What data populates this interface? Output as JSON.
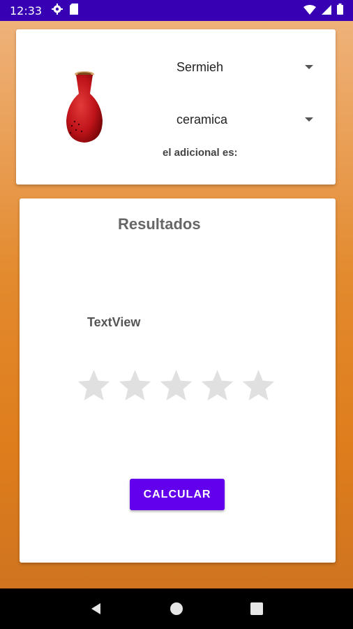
{
  "status_bar": {
    "time": "12:33",
    "icons_left": [
      "gear-icon",
      "sd-card-icon"
    ],
    "icons_right": [
      "wifi-icon",
      "signal-icon",
      "battery-icon"
    ],
    "background": "#3700b3"
  },
  "top_card": {
    "spinner_product": {
      "value": "Sermieh"
    },
    "spinner_material": {
      "value": "ceramica"
    },
    "adicional_label": "el adicional es:"
  },
  "results_card": {
    "title": "Resultados",
    "textview": "TextView",
    "rating": {
      "value": 0,
      "max": 5
    },
    "calculate_button": "CALCULAR"
  },
  "colors": {
    "accent": "#6200ee",
    "background_top": "#efb27a",
    "background_bottom": "#cf7420",
    "star_empty": "#e0e0e0"
  },
  "nav_bar": {
    "buttons": [
      "back-icon",
      "home-icon",
      "recents-icon"
    ]
  }
}
